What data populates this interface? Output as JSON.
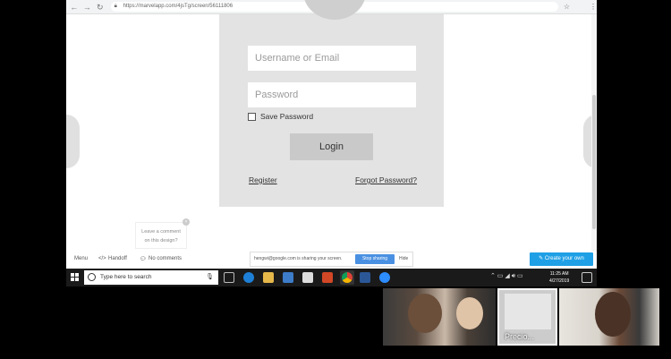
{
  "browser": {
    "url": "https://marvelapp.com/4jsTg/screen/56111806"
  },
  "login": {
    "username_placeholder": "Username or Email",
    "password_placeholder": "Password",
    "save_password_label": "Save Password",
    "login_label": "Login",
    "register_label": "Register",
    "forgot_label": "Forgot Password?"
  },
  "comment": {
    "line1": "Leave a comment",
    "line2": "on this design?"
  },
  "toolbar": {
    "menu_label": "Menu",
    "handoff_label": "Handoff",
    "comments_label": "No comments",
    "sharing_text": "hengwi@google.com is sharing your screen.",
    "stop_sharing_label": "Stop sharing",
    "hide_label": "Hide",
    "create_label": "Create your own"
  },
  "taskbar": {
    "search_placeholder": "Type here to search",
    "time": "11:25 AM",
    "date": "4/27/2019"
  },
  "video": {
    "participant_label": "Precio..."
  },
  "colors": {
    "accent": "#1fa0e6",
    "stop_sharing": "#4a90e2",
    "card": "#e3e3e3"
  }
}
